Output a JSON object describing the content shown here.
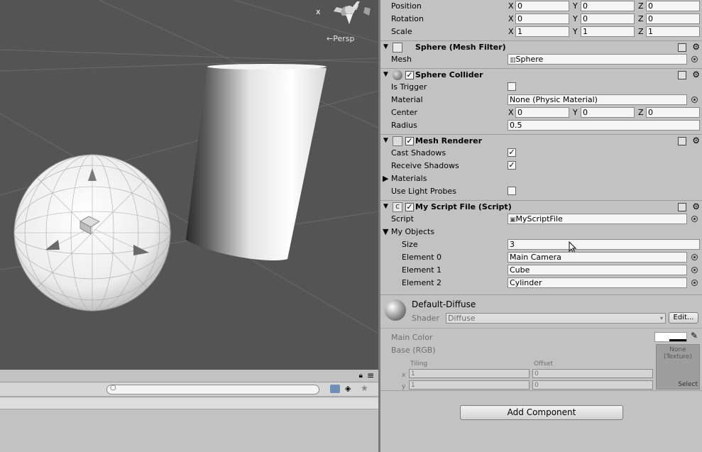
{
  "scene": {
    "camera_label": "←Persp"
  },
  "project": {
    "search_placeholder": ""
  },
  "transform": {
    "position": {
      "label": "Position",
      "x": "0",
      "y": "0",
      "z": "0"
    },
    "rotation": {
      "label": "Rotation",
      "x": "0",
      "y": "0",
      "z": "0"
    },
    "scale": {
      "label": "Scale",
      "x": "1",
      "y": "1",
      "z": "1"
    }
  },
  "axes": {
    "x": "X",
    "y": "Y",
    "z": "Z"
  },
  "mesh_filter": {
    "title": "Sphere (Mesh Filter)",
    "mesh_label": "Mesh",
    "mesh_value": "Sphere"
  },
  "sphere_collider": {
    "title": "Sphere Collider",
    "is_trigger_label": "Is Trigger",
    "material_label": "Material",
    "material_value": "None (Physic Material)",
    "center_label": "Center",
    "center": {
      "x": "0",
      "y": "0",
      "z": "0"
    },
    "radius_label": "Radius",
    "radius_value": "0.5"
  },
  "mesh_renderer": {
    "title": "Mesh Renderer",
    "cast_shadows_label": "Cast Shadows",
    "receive_shadows_label": "Receive Shadows",
    "materials_label": "Materials",
    "light_probes_label": "Use Light Probes"
  },
  "script_comp": {
    "title": "My Script File (Script)",
    "script_label": "Script",
    "script_value": "MyScriptFile",
    "objects_label": "My Objects",
    "size_label": "Size",
    "size_value": "3",
    "elements": [
      {
        "label": "Element 0",
        "value": "Main Camera"
      },
      {
        "label": "Element 1",
        "value": "Cube"
      },
      {
        "label": "Element 2",
        "value": "Cylinder"
      }
    ]
  },
  "material": {
    "name": "Default-Diffuse",
    "shader_label": "Shader",
    "shader_value": "Diffuse",
    "edit_label": "Edit...",
    "main_color_label": "Main Color",
    "base_label": "Base (RGB)",
    "tiling_label": "Tiling",
    "offset_label": "Offset",
    "x_label": "x",
    "y_label": "y",
    "tiling_x": "1",
    "tiling_y": "1",
    "offset_x": "0",
    "offset_y": "0",
    "texture_none": "None",
    "texture_type": "(Texture)",
    "select_label": "Select"
  },
  "add_component_label": "Add Component"
}
